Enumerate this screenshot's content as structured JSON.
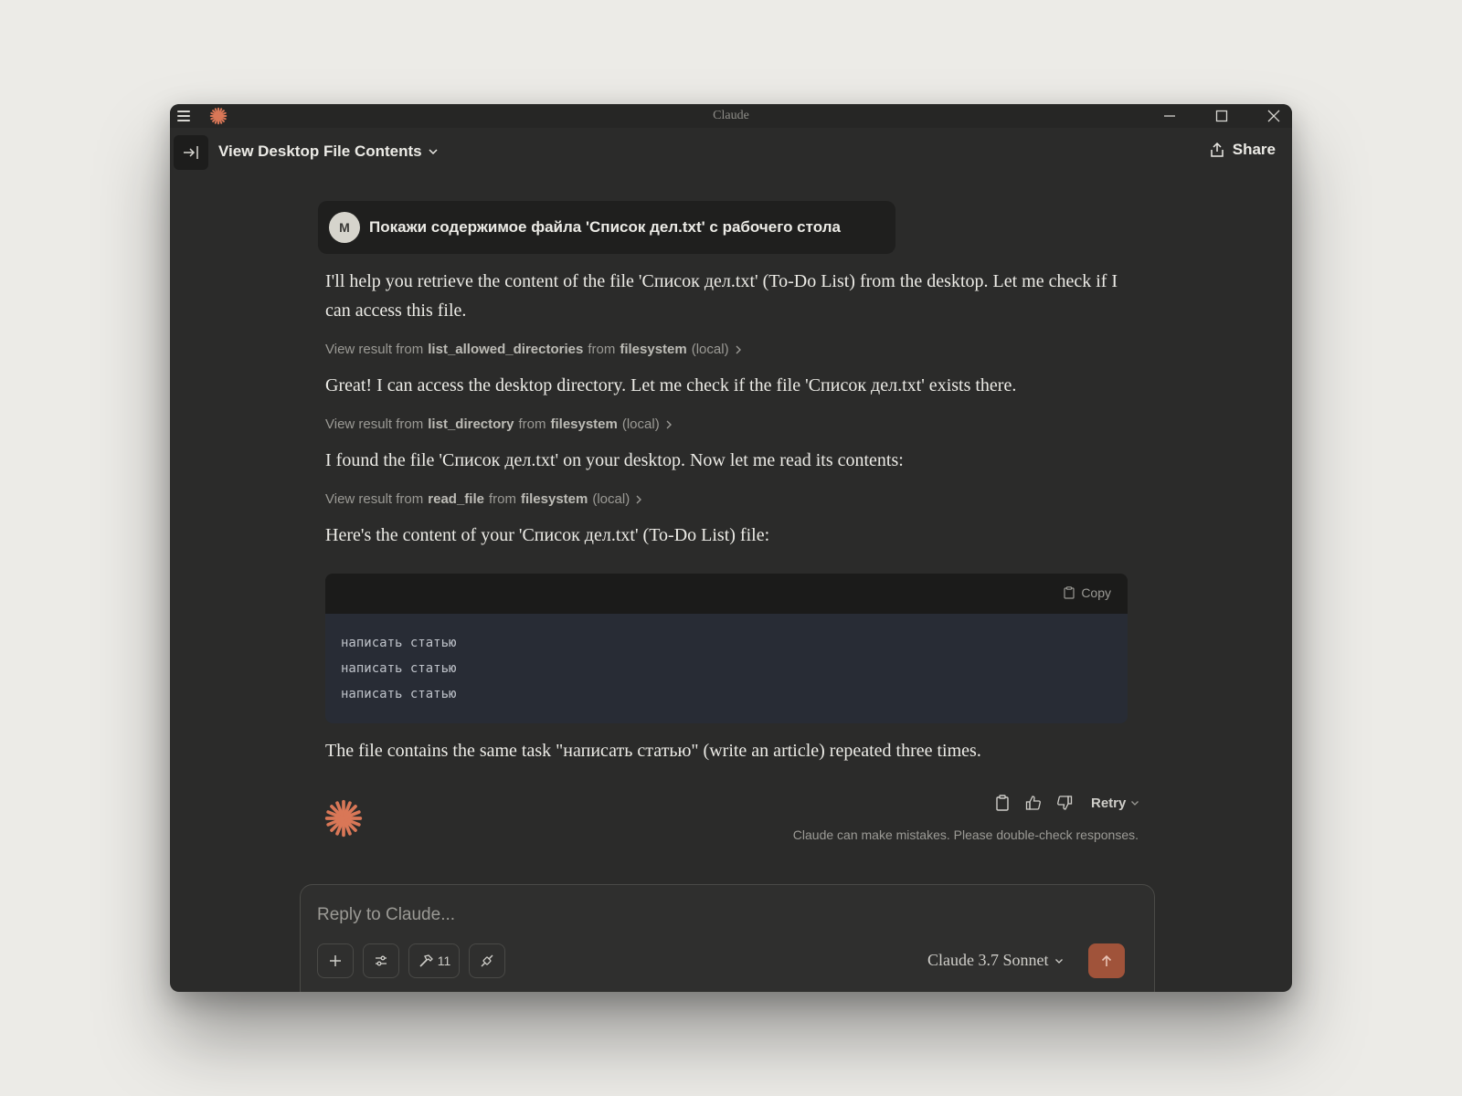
{
  "window": {
    "title": "Claude"
  },
  "header": {
    "conversation_title": "View Desktop File Contents",
    "share_label": "Share"
  },
  "user_message": {
    "avatar_initial": "M",
    "text": "Покажи содержимое файла 'Список дел.txt' с рабочего стола"
  },
  "assistant": {
    "messages": [
      "I'll help you retrieve the content of the file 'Список дел.txt' (To-Do List) from the desktop. Let me check if I can access this file.",
      "Great! I can access the desktop directory. Let me check if the file 'Список дел.txt' exists there.",
      "I found the file 'Список дел.txt' on your desktop. Now let me read its contents:",
      "Here's the content of your 'Список дел.txt' (To-Do List) file:",
      "The file contains the same task \"написать статью\" (write an article) repeated three times."
    ],
    "tool_results": [
      {
        "prefix": "View result from",
        "tool": "list_allowed_directories",
        "from": "from",
        "server": "filesystem",
        "scope": "(local)"
      },
      {
        "prefix": "View result from",
        "tool": "list_directory",
        "from": "from",
        "server": "filesystem",
        "scope": "(local)"
      },
      {
        "prefix": "View result from",
        "tool": "read_file",
        "from": "from",
        "server": "filesystem",
        "scope": "(local)"
      }
    ],
    "code": {
      "copy_label": "Copy",
      "lines": [
        "написать статью",
        "написать статью",
        "написать статью"
      ]
    }
  },
  "actions": {
    "retry_label": "Retry",
    "disclaimer": "Claude can make mistakes. Please double-check responses."
  },
  "composer": {
    "placeholder": "Reply to Claude...",
    "tools_count": "11",
    "model": "Claude 3.7 Sonnet"
  },
  "colors": {
    "accent": "#d97757",
    "send": "#a0533a",
    "window_bg": "#2b2b2a",
    "code_bg": "#282c35"
  }
}
